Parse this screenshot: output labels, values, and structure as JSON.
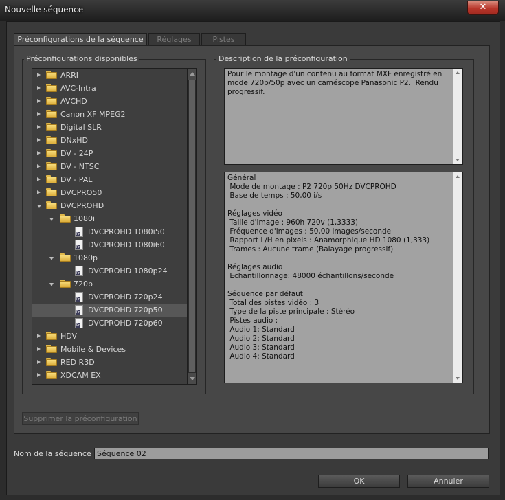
{
  "window": {
    "title": "Nouvelle séquence",
    "close_glyph": "✕"
  },
  "tabs": [
    {
      "label": "Préconfigurations de la séquence",
      "active": true
    },
    {
      "label": "Réglages",
      "active": false
    },
    {
      "label": "Pistes",
      "active": false
    }
  ],
  "presets_group": {
    "label": "Préconfigurations disponibles"
  },
  "tree": [
    {
      "label": "ARRI",
      "type": "folder",
      "level": 0,
      "state": "collapsed"
    },
    {
      "label": "AVC-Intra",
      "type": "folder",
      "level": 0,
      "state": "collapsed"
    },
    {
      "label": "AVCHD",
      "type": "folder",
      "level": 0,
      "state": "collapsed"
    },
    {
      "label": "Canon XF MPEG2",
      "type": "folder",
      "level": 0,
      "state": "collapsed"
    },
    {
      "label": "Digital SLR",
      "type": "folder",
      "level": 0,
      "state": "collapsed"
    },
    {
      "label": "DNxHD",
      "type": "folder",
      "level": 0,
      "state": "collapsed"
    },
    {
      "label": "DV - 24P",
      "type": "folder",
      "level": 0,
      "state": "collapsed"
    },
    {
      "label": "DV - NTSC",
      "type": "folder",
      "level": 0,
      "state": "collapsed"
    },
    {
      "label": "DV - PAL",
      "type": "folder",
      "level": 0,
      "state": "collapsed"
    },
    {
      "label": "DVCPRO50",
      "type": "folder",
      "level": 0,
      "state": "collapsed"
    },
    {
      "label": "DVCPROHD",
      "type": "folder",
      "level": 0,
      "state": "expanded"
    },
    {
      "label": "1080i",
      "type": "folder",
      "level": 1,
      "state": "expanded"
    },
    {
      "label": "DVCPROHD 1080i50",
      "type": "preset",
      "level": 2
    },
    {
      "label": "DVCPROHD 1080i60",
      "type": "preset",
      "level": 2
    },
    {
      "label": "1080p",
      "type": "folder",
      "level": 1,
      "state": "expanded"
    },
    {
      "label": "DVCPROHD 1080p24",
      "type": "preset",
      "level": 2
    },
    {
      "label": "720p",
      "type": "folder",
      "level": 1,
      "state": "expanded"
    },
    {
      "label": "DVCPROHD 720p24",
      "type": "preset",
      "level": 2
    },
    {
      "label": "DVCPROHD 720p50",
      "type": "preset",
      "level": 2,
      "selected": true
    },
    {
      "label": "DVCPROHD 720p60",
      "type": "preset",
      "level": 2
    },
    {
      "label": "HDV",
      "type": "folder",
      "level": 0,
      "state": "collapsed"
    },
    {
      "label": "Mobile & Devices",
      "type": "folder",
      "level": 0,
      "state": "collapsed"
    },
    {
      "label": "RED R3D",
      "type": "folder",
      "level": 0,
      "state": "collapsed"
    },
    {
      "label": "XDCAM EX",
      "type": "folder",
      "level": 0,
      "state": "collapsed"
    }
  ],
  "description_group": {
    "label": "Description de la préconfiguration"
  },
  "description_text": "Pour le montage d'un contenu au format MXF enregistré en mode 720p/50p avec un caméscope Panasonic P2.  Rendu progressif.",
  "details_lines": [
    "Général",
    " Mode de montage : P2 720p 50Hz DVCPROHD",
    " Base de temps : 50,00 i/s",
    "",
    "Réglages vidéo",
    " Taille d'image : 960h 720v (1,3333)",
    " Fréquence d'images : 50,00 images/seconde",
    " Rapport L/H en pixels : Anamorphique HD 1080 (1,333)",
    " Trames : Aucune trame (Balayage progressif)",
    "",
    "Réglages audio",
    " Echantillonnage: 48000 échantillons/seconde",
    "",
    "Séquence par défaut",
    " Total des pistes vidéo : 3",
    " Type de la piste principale : Stéréo",
    " Pistes audio :",
    " Audio 1: Standard",
    " Audio 2: Standard",
    " Audio 3: Standard",
    " Audio 4: Standard"
  ],
  "delete_button": {
    "label": "Supprimer la préconfiguration",
    "enabled": false
  },
  "sequence_name": {
    "label": "Nom de la séquence :",
    "value": "Séquence 02"
  },
  "buttons": {
    "ok": "OK",
    "cancel": "Annuler"
  },
  "colors": {
    "close_button": "#b8352a",
    "selected_row": "#575757",
    "folder": "#f0cc5a",
    "text_field": "#a2a2a2"
  }
}
